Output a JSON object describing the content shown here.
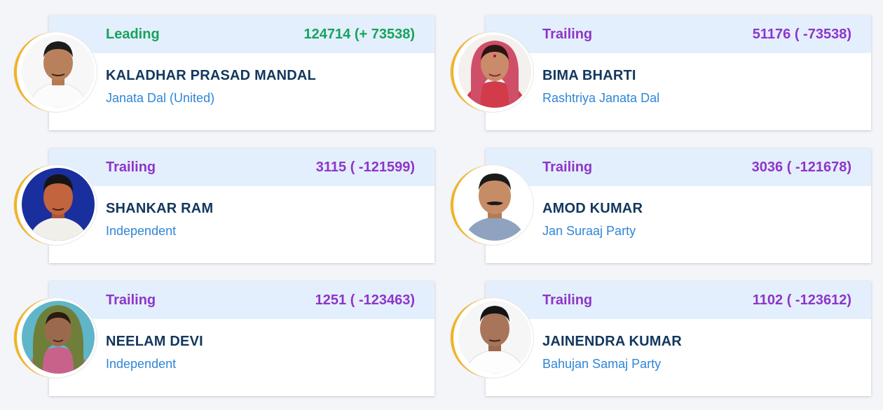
{
  "candidates": [
    {
      "status": "Leading",
      "votes": "124714 (+ 73538)",
      "name": "KALADHAR PRASAD MANDAL",
      "party": "Janata Dal (United)"
    },
    {
      "status": "Trailing",
      "votes": "51176 ( -73538)",
      "name": "BIMA BHARTI",
      "party": "Rashtriya Janata Dal"
    },
    {
      "status": "Trailing",
      "votes": "3115 ( -121599)",
      "name": "SHANKAR RAM",
      "party": "Independent"
    },
    {
      "status": "Trailing",
      "votes": "3036 ( -121678)",
      "name": "AMOD KUMAR",
      "party": "Jan Suraaj Party"
    },
    {
      "status": "Trailing",
      "votes": "1251 ( -123463)",
      "name": "NEELAM DEVI",
      "party": "Independent"
    },
    {
      "status": "Trailing",
      "votes": "1102 ( -123612)",
      "name": "JAINENDRA KUMAR",
      "party": "Bahujan Samaj Party"
    }
  ],
  "colors": {
    "leading": "#17a35c",
    "trailing": "#8e35c9",
    "header_bg": "#e3effc",
    "name": "#12375e",
    "party": "#2f86d6",
    "avatar_ring": "#f0b323"
  }
}
